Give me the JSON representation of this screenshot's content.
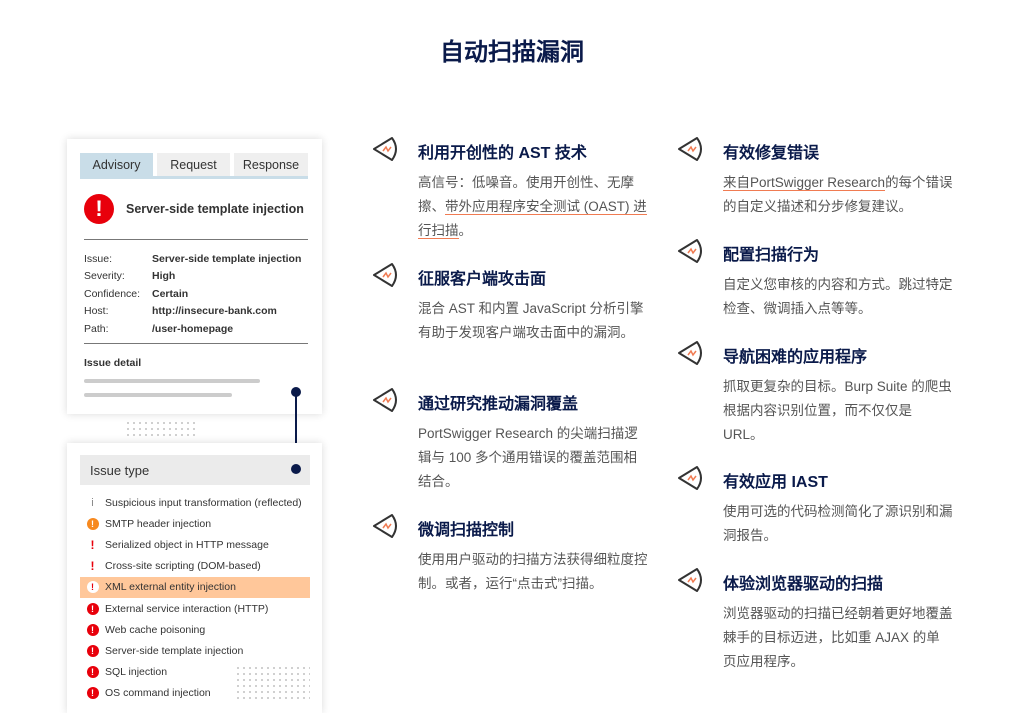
{
  "page_title": "自动扫描漏洞",
  "advisory": {
    "tabs": [
      "Advisory",
      "Request",
      "Response"
    ],
    "heading": "Server-side template injection",
    "rows": [
      {
        "k": "Issue:",
        "v": "Server-side template injection"
      },
      {
        "k": "Severity:",
        "v": "High"
      },
      {
        "k": "Confidence:",
        "v": "Certain"
      },
      {
        "k": "Host:",
        "v": "http://insecure-bank.com"
      },
      {
        "k": "Path:",
        "v": "/user-homepage"
      }
    ],
    "detail_label": "Issue detail"
  },
  "issue_types": {
    "header": "Issue type",
    "items": [
      {
        "label": "Suspicious input transformation (reflected)",
        "severity": "info"
      },
      {
        "label": "SMTP header injection",
        "severity": "medium"
      },
      {
        "label": "Serialized object in HTTP message",
        "severity": "low"
      },
      {
        "label": "Cross-site scripting (DOM-based)",
        "severity": "low"
      },
      {
        "label": "XML external entity injection",
        "severity": "high",
        "selected": true
      },
      {
        "label": "External service interaction (HTTP)",
        "severity": "high"
      },
      {
        "label": "Web cache poisoning",
        "severity": "high"
      },
      {
        "label": "Server-side template injection",
        "severity": "high"
      },
      {
        "label": "SQL injection",
        "severity": "high"
      },
      {
        "label": "OS command injection",
        "severity": "high"
      }
    ]
  },
  "features": [
    {
      "title": "利用开创性的 AST 技术",
      "pre": "高信号：低噪音。使用开创性、无摩擦、",
      "link": "带外应用程序安全测试 (OAST) 进行扫描",
      "post": "。"
    },
    {
      "title": "征服客户端攻击面",
      "pre": "混合 AST 和内置 JavaScript 分析引擎有助于发现客户端攻击面中的漏洞。"
    },
    {
      "title": "通过研究推动漏洞覆盖",
      "pre": "PortSwigger Research 的尖端扫描逻辑与 100 多个通用错误的覆盖范围相结合。"
    },
    {
      "title": "微调扫描控制",
      "pre": "使用用户驱动的扫描方法获得细粒度控制。或者，运行“点击式”扫描。"
    },
    {
      "title": "有效修复错误",
      "pre": "",
      "link": "来自PortSwigger Research",
      "post": "的每个错误的自定义描述和分步修复建议。"
    },
    {
      "title": "配置扫描行为",
      "pre": "自定义您审核的内容和方式。跳过特定检查、微调插入点等等。"
    },
    {
      "title": "导航困难的应用程序",
      "pre": "抓取更复杂的目标。Burp Suite 的爬虫根据内容识别位置，而不仅仅是 URL。"
    },
    {
      "title": "有效应用 IAST",
      "pre": "使用可选的代码检测简化了源识别和漏洞报告。"
    },
    {
      "title": "体验浏览器驱动的扫描",
      "pre": "浏览器驱动的扫描已经朝着更好地覆盖棘手的目标迈进，比如重 AJAX 的单页应用程序。"
    }
  ],
  "colors": {
    "navy": "#0a1a4a",
    "accent": "#f07b52",
    "high": "#e8000b",
    "medium": "#f7891f",
    "highlight": "#ffc79a"
  }
}
